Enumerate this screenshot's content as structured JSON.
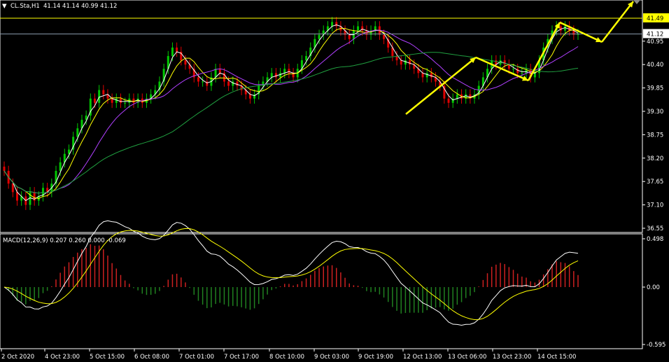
{
  "header": {
    "symbol": "CL.Sta,H1",
    "ohlc": "41.14 41.14 40.99 41.12",
    "macd_label": "MACD(12,26,9) 0.207 0.260 0.000 -0.069"
  },
  "colors": {
    "background": "#000000",
    "bull_candle": "#00c800",
    "bear_candle": "#e00000",
    "ma_fast": "#ffffff",
    "ma_mid": "#ffff00",
    "ma_slow": "#b040ff",
    "ma_long": "#20a040",
    "hline": "#ffff00",
    "macd_line": "#ffffff",
    "signal_line": "#ffff00",
    "hist_pos": "#cc2020",
    "hist_neg": "#208020",
    "arrow": "#ffff00",
    "axis": "#ffffff"
  },
  "chart_data": [
    {
      "type": "candlestick",
      "title": "CL.Sta,H1",
      "price_levels_marked": {
        "resistance": 41.49,
        "current": 41.12
      },
      "ylim": [
        36.55,
        41.6
      ],
      "y_ticks": [
        "41.49",
        "41.12",
        "40.95",
        "40.40",
        "39.85",
        "39.30",
        "38.75",
        "38.20",
        "37.65",
        "37.10",
        "36.55"
      ],
      "x_ticks": [
        "2 Oct 2020",
        "4 Oct 23:00",
        "5 Oct 15:00",
        "6 Oct 08:00",
        "7 Oct 01:00",
        "7 Oct 17:00",
        "8 Oct 10:00",
        "9 Oct 03:00",
        "9 Oct 19:00",
        "12 Oct 13:00",
        "13 Oct 06:00",
        "13 Oct 23:00",
        "14 Oct 15:00"
      ],
      "close": [
        37.9,
        37.6,
        37.4,
        37.2,
        37.3,
        37.1,
        37.4,
        37.2,
        37.3,
        37.5,
        37.4,
        37.6,
        37.9,
        38.1,
        38.3,
        38.4,
        38.7,
        38.9,
        39.1,
        39.2,
        39.6,
        39.5,
        39.8,
        39.7,
        39.6,
        39.5,
        39.6,
        39.5,
        39.5,
        39.6,
        39.5,
        39.6,
        39.5,
        39.6,
        39.7,
        39.8,
        40.0,
        40.3,
        40.6,
        40.8,
        40.7,
        40.5,
        40.4,
        40.3,
        40.1,
        40.0,
        40.0,
        39.9,
        40.1,
        40.3,
        40.2,
        40.0,
        39.9,
        40.0,
        39.9,
        39.8,
        39.7,
        39.6,
        39.7,
        39.9,
        40.0,
        40.1,
        40.2,
        40.1,
        40.2,
        40.3,
        40.2,
        40.1,
        40.3,
        40.5,
        40.6,
        40.8,
        41.0,
        41.1,
        41.2,
        41.3,
        41.4,
        41.3,
        41.2,
        41.1,
        41.0,
        41.2,
        41.3,
        41.2,
        41.1,
        41.2,
        41.3,
        41.1,
        41.0,
        40.8,
        40.6,
        40.5,
        40.4,
        40.5,
        40.4,
        40.3,
        40.2,
        40.1,
        40.2,
        40.1,
        40.0,
        39.9,
        39.6,
        39.5,
        39.6,
        39.7,
        39.6,
        39.7,
        39.6,
        39.7,
        39.9,
        40.1,
        40.3,
        40.5,
        40.4,
        40.5,
        40.4,
        40.3,
        40.3,
        40.2,
        40.2,
        40.3,
        40.1,
        40.2,
        40.5,
        40.8,
        41.0,
        41.2,
        41.3,
        41.2,
        41.3,
        41.2,
        41.1,
        41.12
      ],
      "series": [
        {
          "name": "MACD",
          "panel": "macd",
          "ylim": [
            -0.595,
            0.498
          ],
          "y_ticks": [
            "0.498",
            "0.00",
            "-0.595"
          ]
        }
      ]
    }
  ]
}
